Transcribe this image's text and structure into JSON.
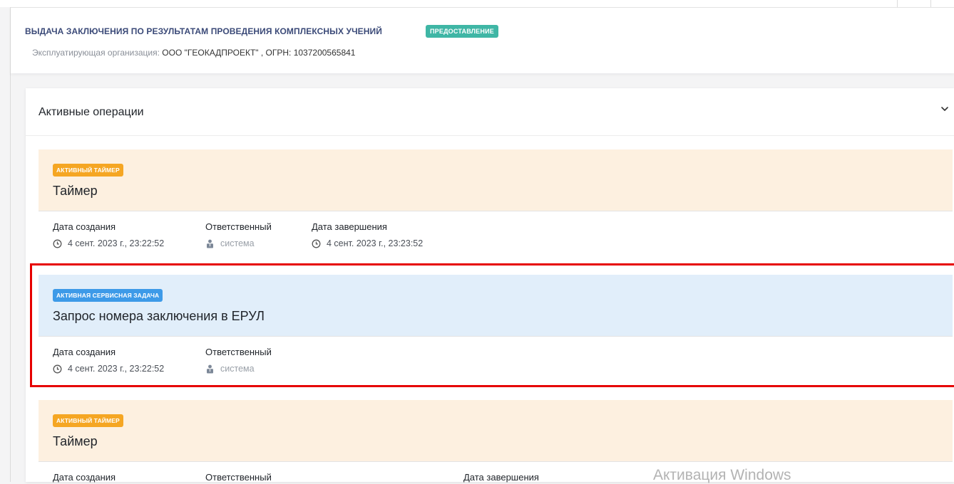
{
  "header": {
    "title": "ВЫДАЧА ЗАКЛЮЧЕНИЯ ПО РЕЗУЛЬТАТАМ ПРОВЕДЕНИЯ КОМПЛЕКСНЫХ УЧЕНИЙ",
    "status_badge": "ПРЕДОСТАВЛЕНИЕ",
    "org_label": "Эксплуатирующая организация:",
    "org_value": "ООО \"ГЕОКАДПРОЕКТ\" , ОГРН: 1037200565841"
  },
  "panel": {
    "title": "Активные операции"
  },
  "labels": {
    "created": "Дата создания",
    "responsible": "Ответственный",
    "completed": "Дата завершения"
  },
  "operations": [
    {
      "badge": "АКТИВНЫЙ ТАЙМЕР",
      "title": "Таймер",
      "created": "4 сент. 2023 г., 23:22:52",
      "responsible": "система",
      "completed": "4 сент. 2023 г., 23:23:52"
    },
    {
      "badge": "АКТИВНАЯ СЕРВИСНАЯ ЗАДАЧА",
      "title": "Запрос номера заключения в ЕРУЛ",
      "created": "4 сент. 2023 г., 23:22:52",
      "responsible": "система"
    },
    {
      "badge": "АКТИВНЫЙ ТАЙМЕР",
      "title": "Таймер"
    }
  ],
  "watermark": "Активация Windows",
  "colors": {
    "timer_bg": "#fdf0e0",
    "timer_badge": "#f5a623",
    "service_bg": "#e1eefa",
    "service_badge": "#3d9ae8",
    "status_badge": "#3fb6a5",
    "highlight": "#e60000"
  }
}
